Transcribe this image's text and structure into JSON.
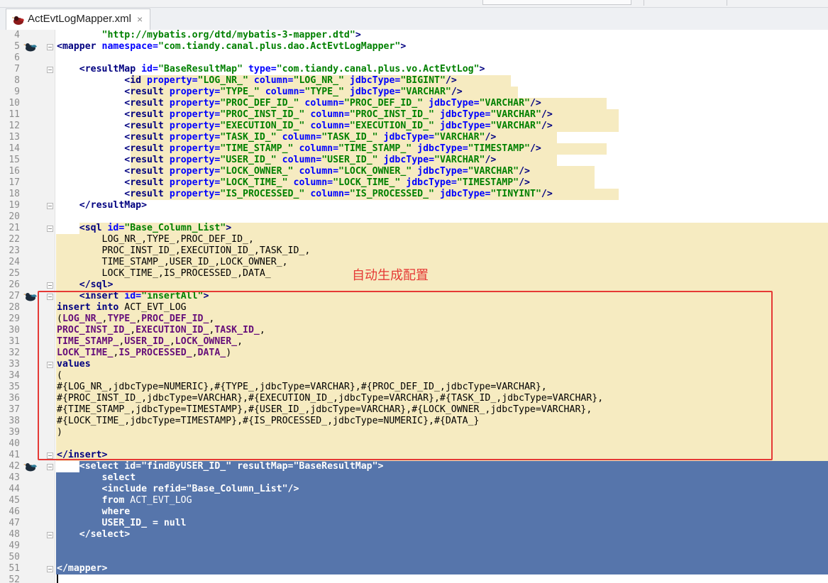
{
  "tab": {
    "label": "ActEvtLogMapper.xml",
    "close": "×",
    "icon": "mybatis-bird-icon"
  },
  "annotation": "自动生成配置",
  "colors": {
    "highlight_yellow": "#f6ebc1",
    "selection_blue": "#5675ab",
    "annotation_red": "#e53935"
  },
  "lines": [
    {
      "n": "4",
      "html": "        <span class=\"val\">\"http://mybatis.org/dtd/mybatis-3-mapper.dtd\"</span><span class=\"b\">&gt;</span>"
    },
    {
      "n": "5",
      "html": "<span class=\"b\">&lt;mapper </span><span class=\"attr\">namespace=</span><span class=\"val\">\"com.tiandy.canal.plus.dao.ActEvtLogMapper\"</span><span class=\"b\">&gt;</span>"
    },
    {
      "n": "6",
      "html": ""
    },
    {
      "n": "7",
      "html": "    <span class=\"b\">&lt;resultMap </span><span class=\"attr\">id=</span><span class=\"val\">\"BaseResultMap\" </span><span class=\"attr\">type=</span><span class=\"val\">\"com.tiandy.canal.plus.vo.ActEvtLog\"</span><span class=\"b\">&gt;</span>"
    },
    {
      "n": "8",
      "html": "            <span class=\"b\">&lt;id </span><span class=\"attr\">property=</span><span class=\"val\">\"LOG_NR_\" </span><span class=\"attr\">column=</span><span class=\"val\">\"LOG_NR_\" </span><span class=\"attr\">jdbcType=</span><span class=\"val\">\"BIGINT\"</span><span class=\"b\">/&gt;</span>"
    },
    {
      "n": "9",
      "html": "            <span class=\"b\">&lt;result </span><span class=\"attr\">property=</span><span class=\"val\">\"TYPE_\" </span><span class=\"attr\">column=</span><span class=\"val\">\"TYPE_\" </span><span class=\"attr\">jdbcType=</span><span class=\"val\">\"VARCHAR\"</span><span class=\"b\">/&gt;</span>"
    },
    {
      "n": "10",
      "html": "            <span class=\"b\">&lt;result </span><span class=\"attr\">property=</span><span class=\"val\">\"PROC_DEF_ID_\" </span><span class=\"attr\">column=</span><span class=\"val\">\"PROC_DEF_ID_\" </span><span class=\"attr\">jdbcType=</span><span class=\"val\">\"VARCHAR\"</span><span class=\"b\">/&gt;</span>"
    },
    {
      "n": "11",
      "html": "            <span class=\"b\">&lt;result </span><span class=\"attr\">property=</span><span class=\"val\">\"PROC_INST_ID_\" </span><span class=\"attr\">column=</span><span class=\"val\">\"PROC_INST_ID_\" </span><span class=\"attr\">jdbcType=</span><span class=\"val\">\"VARCHAR\"</span><span class=\"b\">/&gt;</span>"
    },
    {
      "n": "12",
      "html": "            <span class=\"b\">&lt;result </span><span class=\"attr\">property=</span><span class=\"val\">\"EXECUTION_ID_\" </span><span class=\"attr\">column=</span><span class=\"val\">\"EXECUTION_ID_\" </span><span class=\"attr\">jdbcType=</span><span class=\"val\">\"VARCHAR\"</span><span class=\"b\">/&gt;</span>"
    },
    {
      "n": "13",
      "html": "            <span class=\"b\">&lt;result </span><span class=\"attr\">property=</span><span class=\"val\">\"TASK_ID_\" </span><span class=\"attr\">column=</span><span class=\"val\">\"TASK_ID_\" </span><span class=\"attr\">jdbcType=</span><span class=\"val\">\"VARCHAR\"</span><span class=\"b\">/&gt;</span>"
    },
    {
      "n": "14",
      "html": "            <span class=\"b\">&lt;result </span><span class=\"attr\">property=</span><span class=\"val\">\"TIME_STAMP_\" </span><span class=\"attr\">column=</span><span class=\"val\">\"TIME_STAMP_\" </span><span class=\"attr\">jdbcType=</span><span class=\"val\">\"TIMESTAMP\"</span><span class=\"b\">/&gt;</span>"
    },
    {
      "n": "15",
      "html": "            <span class=\"b\">&lt;result </span><span class=\"attr\">property=</span><span class=\"val\">\"USER_ID_\" </span><span class=\"attr\">column=</span><span class=\"val\">\"USER_ID_\" </span><span class=\"attr\">jdbcType=</span><span class=\"val\">\"VARCHAR\"</span><span class=\"b\">/&gt;</span>"
    },
    {
      "n": "16",
      "html": "            <span class=\"b\">&lt;result </span><span class=\"attr\">property=</span><span class=\"val\">\"LOCK_OWNER_\" </span><span class=\"attr\">column=</span><span class=\"val\">\"LOCK_OWNER_\" </span><span class=\"attr\">jdbcType=</span><span class=\"val\">\"VARCHAR\"</span><span class=\"b\">/&gt;</span>"
    },
    {
      "n": "17",
      "html": "            <span class=\"b\">&lt;result </span><span class=\"attr\">property=</span><span class=\"val\">\"LOCK_TIME_\" </span><span class=\"attr\">column=</span><span class=\"val\">\"LOCK_TIME_\" </span><span class=\"attr\">jdbcType=</span><span class=\"val\">\"TIMESTAMP\"</span><span class=\"b\">/&gt;</span>"
    },
    {
      "n": "18",
      "html": "            <span class=\"b\">&lt;result </span><span class=\"attr\">property=</span><span class=\"val\">\"IS_PROCESSED_\" </span><span class=\"attr\">column=</span><span class=\"val\">\"IS_PROCESSED_\" </span><span class=\"attr\">jdbcType=</span><span class=\"val\">\"TINYINT\"</span><span class=\"b\">/&gt;</span>"
    },
    {
      "n": "19",
      "html": "    <span class=\"b\">&lt;/resultMap&gt;</span>"
    },
    {
      "n": "20",
      "html": ""
    },
    {
      "n": "21",
      "html": "    <span class=\"b\">&lt;sql </span><span class=\"attr\">id=</span><span class=\"val\">\"Base_Column_List\"</span><span class=\"b\">&gt;</span>"
    },
    {
      "n": "22",
      "html": "<span class=\"c\">        LOG_NR_,TYPE_,PROC_DEF_ID_,</span>"
    },
    {
      "n": "23",
      "html": "<span class=\"c\">        PROC_INST_ID_,EXECUTION_ID_,TASK_ID_,</span>"
    },
    {
      "n": "24",
      "html": "<span class=\"c\">        TIME_STAMP_,USER_ID_,LOCK_OWNER_,</span>"
    },
    {
      "n": "25",
      "html": "<span class=\"c\">        LOCK_TIME_,IS_PROCESSED_,DATA_</span>"
    },
    {
      "n": "26",
      "html": "    <span class=\"b\">&lt;/sql&gt;</span>"
    },
    {
      "n": "27",
      "html": "    <span class=\"b\">&lt;insert </span><span class=\"attr\">id=</span><span class=\"val\">\"insertAll\"</span><span class=\"b\">&gt;</span>"
    },
    {
      "n": "28",
      "html": "<span class=\"b\">insert into </span><span class=\"c\">ACT_EVT_LOG</span>"
    },
    {
      "n": "29",
      "html": "<span class=\"c\">(</span><span class=\"p\">LOG_NR_</span><span class=\"c\">,</span><span class=\"p\">TYPE_</span><span class=\"c\">,</span><span class=\"p\">PROC_DEF_ID_</span><span class=\"c\">,</span>"
    },
    {
      "n": "30",
      "html": "<span class=\"p\">PROC_INST_ID_</span><span class=\"c\">,</span><span class=\"p\">EXECUTION_ID_</span><span class=\"c\">,</span><span class=\"p\">TASK_ID_</span><span class=\"c\">,</span>"
    },
    {
      "n": "31",
      "html": "<span class=\"p\">TIME_STAMP_</span><span class=\"c\">,</span><span class=\"p\">USER_ID_</span><span class=\"c\">,</span><span class=\"p\">LOCK_OWNER_</span><span class=\"c\">,</span>"
    },
    {
      "n": "32",
      "html": "<span class=\"p\">LOCK_TIME_</span><span class=\"c\">,</span><span class=\"p\">IS_PROCESSED_</span><span class=\"c\">,</span><span class=\"p\">DATA_</span><span class=\"c\">)</span>"
    },
    {
      "n": "33",
      "html": "<span class=\"b\">values</span>"
    },
    {
      "n": "34",
      "html": "<span class=\"c\">(</span>"
    },
    {
      "n": "35",
      "html": "<span class=\"c\">#{LOG_NR_,jdbcType=NUMERIC},#{TYPE_,jdbcType=VARCHAR},#{PROC_DEF_ID_,jdbcType=VARCHAR},</span>"
    },
    {
      "n": "36",
      "html": "<span class=\"c\">#{PROC_INST_ID_,jdbcType=VARCHAR},#{EXECUTION_ID_,jdbcType=VARCHAR},#{TASK_ID_,jdbcType=VARCHAR},</span>"
    },
    {
      "n": "37",
      "html": "<span class=\"c\">#{TIME_STAMP_,jdbcType=TIMESTAMP},#{USER_ID_,jdbcType=VARCHAR},#{LOCK_OWNER_,jdbcType=VARCHAR},</span>"
    },
    {
      "n": "38",
      "html": "<span class=\"c\">#{LOCK_TIME_,jdbcType=TIMESTAMP},#{IS_PROCESSED_,jdbcType=NUMERIC},#{DATA_}</span>"
    },
    {
      "n": "39",
      "html": "<span class=\"c\">)</span>"
    },
    {
      "n": "40",
      "html": ""
    },
    {
      "n": "41",
      "html": "<span class=\"b\">&lt;/insert&gt;</span>"
    },
    {
      "n": "42",
      "html": "    <span style=\"color:#ffffff\">&lt;select id=\"findByUSER_ID_\" resultMap=\"BaseResultMap\"&gt;</span>"
    },
    {
      "n": "43",
      "html": "<span style=\"color:#ffffff\">        select</span>"
    },
    {
      "n": "44",
      "html": "<span style=\"color:#ffffff\">        &lt;include refid=\"Base_Column_List\"/&gt;</span>"
    },
    {
      "n": "45",
      "html": "<span style=\"color:#ffffff\">        from </span><span style=\"color:#ffffff;font-weight:normal\">ACT_EVT_LOG</span>"
    },
    {
      "n": "46",
      "html": "<span style=\"color:#ffffff\">        where</span>"
    },
    {
      "n": "47",
      "html": "<span style=\"color:#ffffff\">        USER_ID_ = null</span>"
    },
    {
      "n": "48",
      "html": "<span style=\"color:#ffffff\">    &lt;/select&gt;</span>"
    },
    {
      "n": "49",
      "html": ""
    },
    {
      "n": "50",
      "html": ""
    },
    {
      "n": "51",
      "html": "<span style=\"color:#ffffff\">&lt;/mapper&gt;</span>"
    },
    {
      "n": "52",
      "html": ""
    }
  ]
}
